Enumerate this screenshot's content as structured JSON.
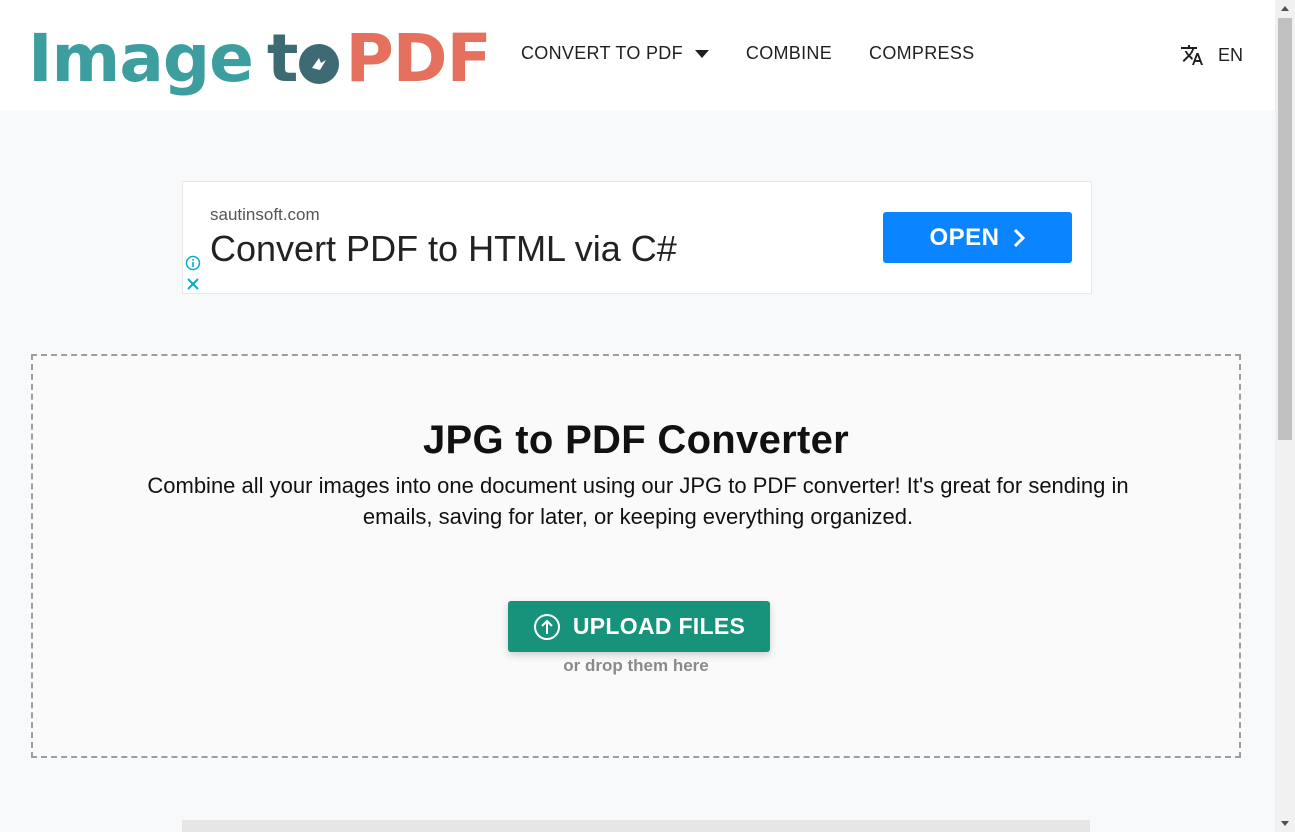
{
  "logo": {
    "part1": "Image",
    "part2": "t",
    "part3": "PDF",
    "colors": {
      "image": "#3d9ea0",
      "to": "#3d6a73",
      "pdf": "#e4705d"
    }
  },
  "nav": {
    "items": [
      {
        "label": "CONVERT TO PDF",
        "has_dropdown": true
      },
      {
        "label": "COMBINE"
      },
      {
        "label": "COMPRESS"
      }
    ],
    "language": {
      "icon": "translate-icon",
      "label": "EN"
    }
  },
  "ad": {
    "domain": "sautinsoft.com",
    "headline": "Convert PDF to HTML via C#",
    "button_label": "OPEN",
    "button_color": "#0a84ff"
  },
  "main": {
    "title": "JPG to PDF Converter",
    "description": "Combine all your images into one document using our JPG to PDF converter! It's great for sending in emails, saving for later, or keeping everything organized.",
    "upload_label": "UPLOAD FILES",
    "upload_color": "#16937a",
    "drop_hint": "or drop them here"
  }
}
